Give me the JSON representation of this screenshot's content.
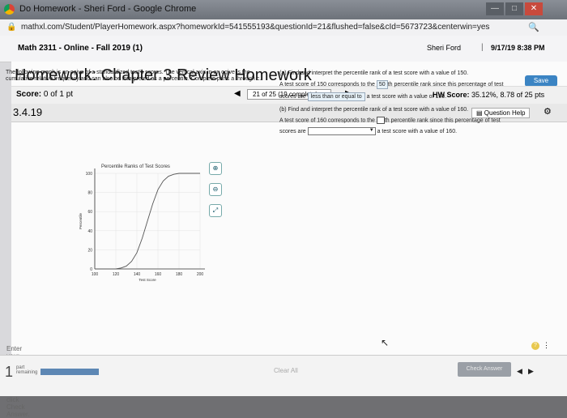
{
  "browser": {
    "title": "Do Homework - Sheri Ford - Google Chrome",
    "url": "mathxl.com/Student/PlayerHomework.aspx?homeworkId=541555193&questionId=21&flushed=false&cId=5673723&centerwin=yes"
  },
  "course": "Math 2311 - Online - Fall 2019 (1)",
  "user": "Sheri Ford",
  "datetime": "9/17/19 8:38 PM",
  "homework": {
    "title": "Homework: Chapter 3 Review Homework",
    "save": "Save"
  },
  "score": {
    "label": "Score:",
    "value": "0 of 1 pt"
  },
  "question_nav": "21 of 25 (19 complete)",
  "hw_score": {
    "label": "HW Score:",
    "value": "35.12%, 8.78 of 25 pts"
  },
  "question_number": "3.4.19",
  "question_help": "Question Help",
  "question_text": "The following graph is an ogive of a standardized test's scores. The vertical axis in an ogive is the cumulative relative frequency and can also be interpreted as a percentile. Complete parts a through c.",
  "part_a": {
    "prompt": "(a) Find and interpret the percentile rank of a test score with a value of 150.",
    "line1a": "A test score of 150 corresponds to the",
    "answer": "50",
    "line1b": "th percentile rank since this percentage of test",
    "line2a": "scores are",
    "select": "less than or equal to",
    "line2b": "a test score with a value of 150."
  },
  "part_b": {
    "prompt": "(b) Find and interpret the percentile rank of a test score with a value of 160.",
    "line1a": "A test score of 160 corresponds to the",
    "line1b": "th percentile rank since this percentage of test",
    "line2a": "scores are",
    "line2b": "a test score with a value of 160."
  },
  "footer": {
    "instruction": "Enter your answer in the answer box and then click Check Answer.",
    "remaining_count": "1",
    "remaining_label": "part remaining",
    "clear": "Clear All",
    "check": "Check Answer"
  },
  "chart_data": {
    "type": "line",
    "title": "Percentile Ranks of Test Scores",
    "xlabel": "Test Score",
    "ylabel": "Percentile",
    "x_ticks": [
      100,
      120,
      140,
      160,
      180,
      200
    ],
    "y_ticks": [
      0,
      20,
      40,
      60,
      80,
      100
    ],
    "xlim": [
      100,
      200
    ],
    "ylim": [
      0,
      100
    ],
    "series": [
      {
        "x": [
          100,
          110,
          120,
          125,
          130,
          135,
          140,
          145,
          150,
          155,
          160,
          165,
          170,
          175,
          180,
          190,
          200
        ],
        "y": [
          0,
          0,
          0,
          1,
          3,
          8,
          17,
          32,
          50,
          68,
          83,
          92,
          97,
          99,
          100,
          100,
          100
        ]
      }
    ]
  }
}
